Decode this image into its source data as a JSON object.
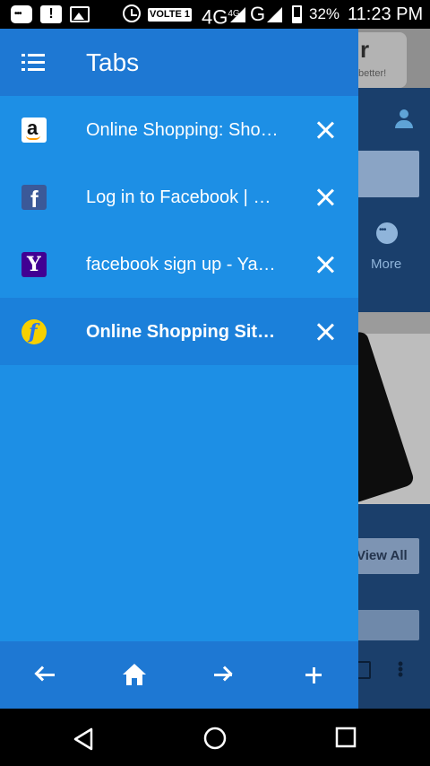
{
  "status_bar": {
    "volte": "VOLTE 1",
    "network_1": "4G",
    "network_1_sup": "4G",
    "network_2": "G",
    "battery": "32%",
    "time": "11:23 PM"
  },
  "background_page": {
    "more_label": "More",
    "view_all_label": "View All",
    "card_letter": "r",
    "card_text": "better!"
  },
  "drawer": {
    "title": "Tabs",
    "tabs": [
      {
        "title": "Online Shopping: Shop Online for Mobiles, Books, Watches",
        "favicon": "amazon-icon",
        "active": false
      },
      {
        "title": "Log in to Facebook | Facebook",
        "favicon": "facebook-icon",
        "active": false
      },
      {
        "title": "facebook sign up - Yahoo Search Results",
        "favicon": "yahoo-icon",
        "active": false
      },
      {
        "title": "Online Shopping Site for Mobiles, Electronics",
        "favicon": "flipkart-icon",
        "active": true
      }
    ]
  },
  "toolbar": {
    "icons": [
      "back-arrow-icon",
      "home-icon",
      "forward-arrow-icon",
      "plus-icon"
    ]
  },
  "colors": {
    "drawer_bg": "#1d8fe5",
    "drawer_header": "#1e78d3",
    "active_tab": "#1b80da"
  }
}
